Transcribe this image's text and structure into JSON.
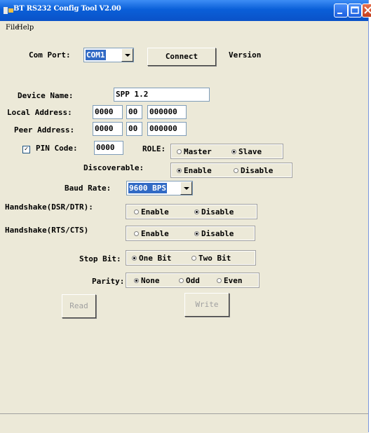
{
  "window": {
    "title": "BT RS232 Config Tool  V2.00"
  },
  "menu": [
    "File",
    "Help"
  ],
  "com_port": {
    "label": "Com Port:",
    "value": "COM1",
    "connect_label": "Connect",
    "version_label": "Version"
  },
  "device_name": {
    "label": "Device Name:",
    "value": "SPP 1.2"
  },
  "local_address": {
    "label": "Local Address:",
    "parts": [
      "0000",
      "00",
      "000000"
    ]
  },
  "peer_address": {
    "label": "Peer Address:",
    "parts": [
      "0000",
      "00",
      "000000"
    ]
  },
  "pin_code": {
    "label": "PIN Code:",
    "value": "0000",
    "checked": true
  },
  "role": {
    "label": "ROLE:",
    "options": [
      "Master",
      "Slave"
    ],
    "selected": "Slave"
  },
  "discoverable": {
    "label": "Discoverable:",
    "options": [
      "Enable",
      "Disable"
    ],
    "selected": "Enable"
  },
  "baud_rate": {
    "label": "Baud Rate:",
    "value": "9600 BPS"
  },
  "handshake_dsr": {
    "label": "Handshake(DSR/DTR):",
    "options": [
      "Enable",
      "Disable"
    ],
    "selected": "Disable"
  },
  "handshake_rts": {
    "label": "Handshake(RTS/CTS)",
    "options": [
      "Enable",
      "Disable"
    ],
    "selected": "Disable"
  },
  "stop_bit": {
    "label": "Stop Bit:",
    "options": [
      "One Bit",
      "Two Bit"
    ],
    "selected": "One Bit"
  },
  "parity": {
    "label": "Parity:",
    "options": [
      "None",
      "Odd",
      "Even"
    ],
    "selected": "None"
  },
  "actions": {
    "read": "Read",
    "write": "Write"
  }
}
